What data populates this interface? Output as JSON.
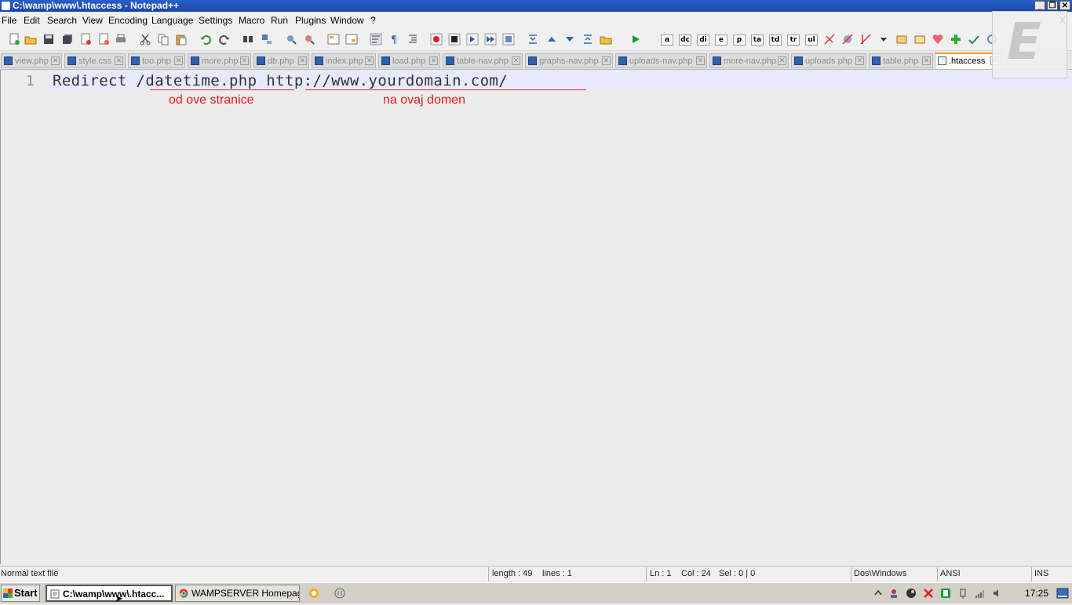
{
  "window": {
    "title": "C:\\wamp\\www\\.htaccess - Notepad++"
  },
  "menu": [
    "File",
    "Edit",
    "Search",
    "View",
    "Encoding",
    "Language",
    "Settings",
    "Macro",
    "Run",
    "Plugins",
    "Window",
    "?"
  ],
  "menu_close": "X",
  "toolbar_letters": [
    "a",
    "dc",
    "di",
    "e",
    "p",
    "ta",
    "td",
    "tr",
    "ul"
  ],
  "tabs": [
    {
      "label": "view.php"
    },
    {
      "label": "style.css"
    },
    {
      "label": "too.php"
    },
    {
      "label": "more.php"
    },
    {
      "label": "db.php"
    },
    {
      "label": "index.php"
    },
    {
      "label": "load.php"
    },
    {
      "label": "table-nav.php"
    },
    {
      "label": "graphs-nav.php"
    },
    {
      "label": "uploads-nav.php"
    },
    {
      "label": "more-nav.php"
    },
    {
      "label": "uploads.php"
    },
    {
      "label": "table.php"
    },
    {
      "label": ".htaccess"
    }
  ],
  "editor": {
    "line_number": "1",
    "code": "Redirect /datetime.php http://www.yourdomain.com/",
    "annotation_1": "od ove stranice",
    "annotation_2": "na ovaj domen"
  },
  "logo_letter": "E",
  "status": {
    "file_type": "Normal text file",
    "length": "length : 49",
    "lines": "lines : 1",
    "ln": "Ln : 1",
    "col": "Col : 24",
    "sel": "Sel : 0 | 0",
    "eol": "Dos\\Windows",
    "encoding": "ANSI",
    "mode": "INS"
  },
  "taskbar": {
    "start": "Start",
    "task_1": "C:\\wamp\\www\\.htacc...",
    "task_2": "WAMPSERVER Homepag...",
    "clock": "17:25"
  },
  "colors": {
    "titlebar": "#2a5fc9",
    "annotation": "#e01a1a",
    "active_tab_accent": "#f4a100"
  }
}
